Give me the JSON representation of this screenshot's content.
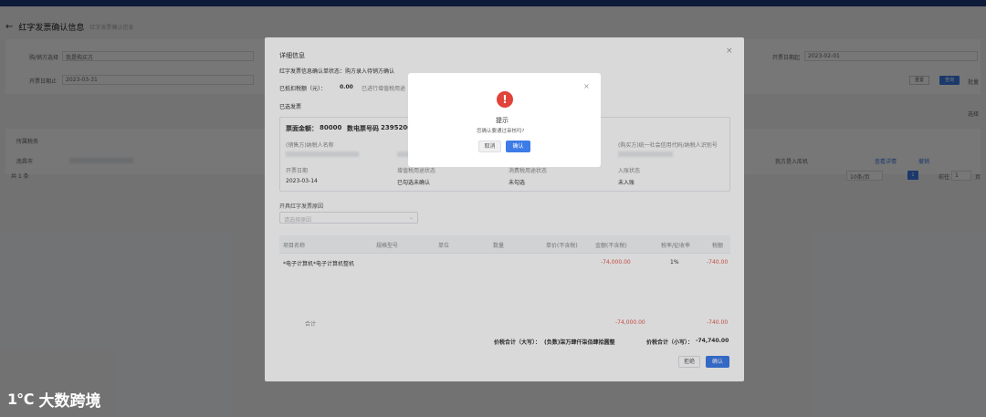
{
  "background": {
    "title": "红字发票确认信息",
    "breadcrumb": "红字发票确认信息",
    "filter_labels": [
      "购/销方选择",
      "开票日期止"
    ],
    "filter_values": [
      "我是购买方",
      "2023-03-31"
    ],
    "right_filter_label": "开票日期起",
    "right_filter_value": "2023-02-01",
    "buttons": [
      "重置",
      "查询"
    ],
    "column_header_left": "所属税务",
    "row_value_left": "南昌市",
    "row_right": [
      "我方是入库机",
      "查看详情",
      "撤销"
    ],
    "total_text": "共 1 条",
    "page_size": "10条/页",
    "page_num": "1",
    "goto_label": "前往",
    "goto_value": "1",
    "goto_suffix": "页",
    "side_button": "批量",
    "right_note": "选择"
  },
  "modal": {
    "title": "详细信息",
    "status_line": "红字发票信息确认单状态：购方录入待销方确认",
    "deduction_label": "已抵扣税额（元）：",
    "deduction_value": "0.00",
    "deduction_note": "已进行增值税用途确认或消费税用途确认的发票，红冲时需要进行相应转出",
    "selected_section": "已选发票",
    "invoice_amount_label": "票面金额：",
    "invoice_amount_value": "80000",
    "invoice_number_label": "数电票号码",
    "invoice_number_value": "2395200",
    "seller_name_label": "(销售方)纳税人名称",
    "buyer_id_label": "(购买方)统一社会信用代码/纳税人识别号",
    "issue_date_label": "开票日期",
    "issue_date_value": "2023-03-14",
    "col2_label": "增值税用途状态",
    "col2_value": "已勾选未确认",
    "col3_label": "消费税用途状态",
    "col3_value": "未勾选",
    "col4_label": "入账状态",
    "col4_value": "未入账",
    "reason_label": "开具红字发票原因",
    "reason_placeholder": "请选择原因",
    "table_headers": [
      "项目名称",
      "规格型号",
      "单位",
      "数量",
      "单价(不含税)",
      "金额(不含税)",
      "税率/征收率",
      "税额"
    ],
    "item_name": "*电子计算机*电子计算机整机",
    "item_amount": "-74,000.00",
    "item_rate": "1%",
    "item_tax": "-740.00",
    "subtotal_label": "合计",
    "subtotal_amount": "-74,000.00",
    "subtotal_tax": "-740.00",
    "total_upper_label": "价税合计（大写）：",
    "total_upper_value": "(负数)柒万肆仟柒佰肆拾圆整",
    "total_lower_label": "价税合计（小写）：",
    "total_lower_value": "-74,740.00",
    "btn_back": "拒绝",
    "btn_confirm": "确认"
  },
  "confirm": {
    "title": "提示",
    "message": "您确认要通过审核吗?",
    "cancel": "取消",
    "ok": "确认"
  },
  "watermark": {
    "logo_text": "1℃",
    "brand_text": "大数跨境"
  },
  "colors": {
    "accent": "#3d7be8",
    "danger": "#e0433a",
    "negative": "#e55a4e"
  }
}
